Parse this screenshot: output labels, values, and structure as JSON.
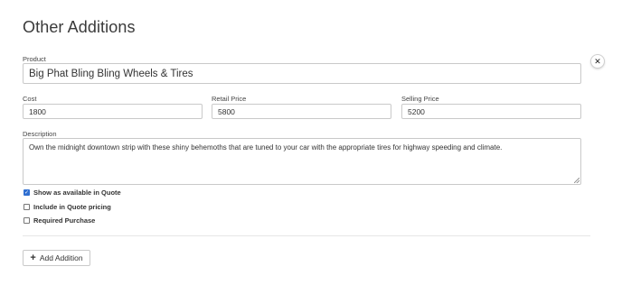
{
  "section": {
    "title": "Other Additions"
  },
  "product": {
    "label": "Product",
    "value": "Big Phat Bling Bling Wheels & Tires"
  },
  "remove": {
    "icon": "close-icon",
    "glyph": "✕"
  },
  "pricing": {
    "cost": {
      "label": "Cost",
      "value": "1800"
    },
    "retail": {
      "label": "Retail Price",
      "value": "5800"
    },
    "selling": {
      "label": "Selling Price",
      "value": "5200"
    }
  },
  "description": {
    "label": "Description",
    "value": "Own the midnight downtown strip with these shiny behemoths that are tuned to your car with the appropriate tires for highway speeding and climate."
  },
  "options": [
    {
      "label": "Show as available in Quote",
      "checked": true
    },
    {
      "label": "Include in Quote pricing",
      "checked": false
    },
    {
      "label": "Required Purchase",
      "checked": false
    }
  ],
  "actions": {
    "add_label": "Add Addition",
    "add_icon": "plus-icon"
  },
  "colors": {
    "accent": "#2f6fd1",
    "border": "#c9c9c9",
    "text": "#333333"
  }
}
